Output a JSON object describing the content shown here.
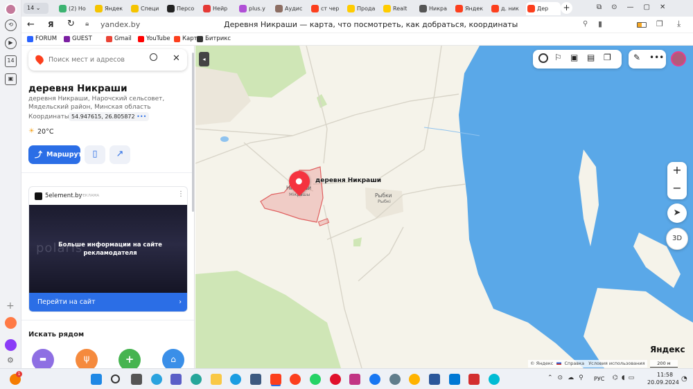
{
  "browser": {
    "tabs": [
      {
        "label": "(2) Но",
        "color": "#3cb371"
      },
      {
        "label": "Яндек",
        "color": "#f5c400"
      },
      {
        "label": "Специ",
        "color": "#f5c400"
      },
      {
        "label": "Персо",
        "color": "#222222"
      },
      {
        "label": "Нейр",
        "color": "#e53935"
      },
      {
        "label": "plus.y",
        "color": "#b04fd6"
      },
      {
        "label": "Аудис",
        "color": "#8d6e63"
      },
      {
        "label": "ст чер",
        "color": "#fc3f1d"
      },
      {
        "label": "Прода",
        "color": "#ffcc00"
      },
      {
        "label": "Realt",
        "color": "#ffcc00"
      },
      {
        "label": "Никра",
        "color": "#555555"
      },
      {
        "label": "Яндек",
        "color": "#fc3f1d"
      },
      {
        "label": "д. ник",
        "color": "#fc3f1d"
      },
      {
        "label": "Дер",
        "color": "#fc3f1d"
      }
    ],
    "tab_counter": "14",
    "url": "yandex.by",
    "page_title": "Деревня Никраши — карта, что посмотреть, как добраться, координаты",
    "bookmarks": [
      {
        "label": "FORUM",
        "icon": "forum-icon",
        "color": "#2962ff"
      },
      {
        "label": "GUEST",
        "icon": "guest-icon",
        "color": "#7b1fa2"
      },
      {
        "label": "Gmail",
        "icon": "gmail-icon",
        "color": "#ea4335"
      },
      {
        "label": "YouTube",
        "icon": "youtube-icon",
        "color": "#ff0000"
      },
      {
        "label": "Карты",
        "icon": "maps-icon",
        "color": "#fc3f1d"
      },
      {
        "label": "Битрикс",
        "icon": "bitrix-icon",
        "color": "#333333"
      }
    ],
    "side_badge": "14"
  },
  "search": {
    "placeholder": "Поиск мест и адресов"
  },
  "place": {
    "title": "деревня Никраши",
    "subtitle": "деревня Никраши, Нарочский сельсовет, Мядельский район, Минская область",
    "coords_label": "Координаты:",
    "coords_value": "54.947615, 26.805872",
    "weather": "20°C",
    "route_label": "Маршрут"
  },
  "ad": {
    "site": "5element.by",
    "tag": "РЕКЛАМА",
    "banner_text": "Больше информации на сайте рекламодателя",
    "brand": "polaris",
    "cta": "Перейти на сайт"
  },
  "nearby": {
    "title": "Искать рядом"
  },
  "map": {
    "pin_label": "деревня Никраши",
    "village_label": "Никраши",
    "village_label_local": "Мікрашы",
    "other_village": "Рыбки",
    "other_village_local": "Рыбкі",
    "btn_3d": "3D",
    "logo": "Яндекс",
    "footer_copyright": "© Яндекс",
    "footer_help": "Справка",
    "footer_terms": "Условия использования",
    "scale": "200 м"
  },
  "taskbar": {
    "lang": "РУС",
    "time": "11:58",
    "date": "20.09.2024",
    "notif_badge": "1"
  }
}
